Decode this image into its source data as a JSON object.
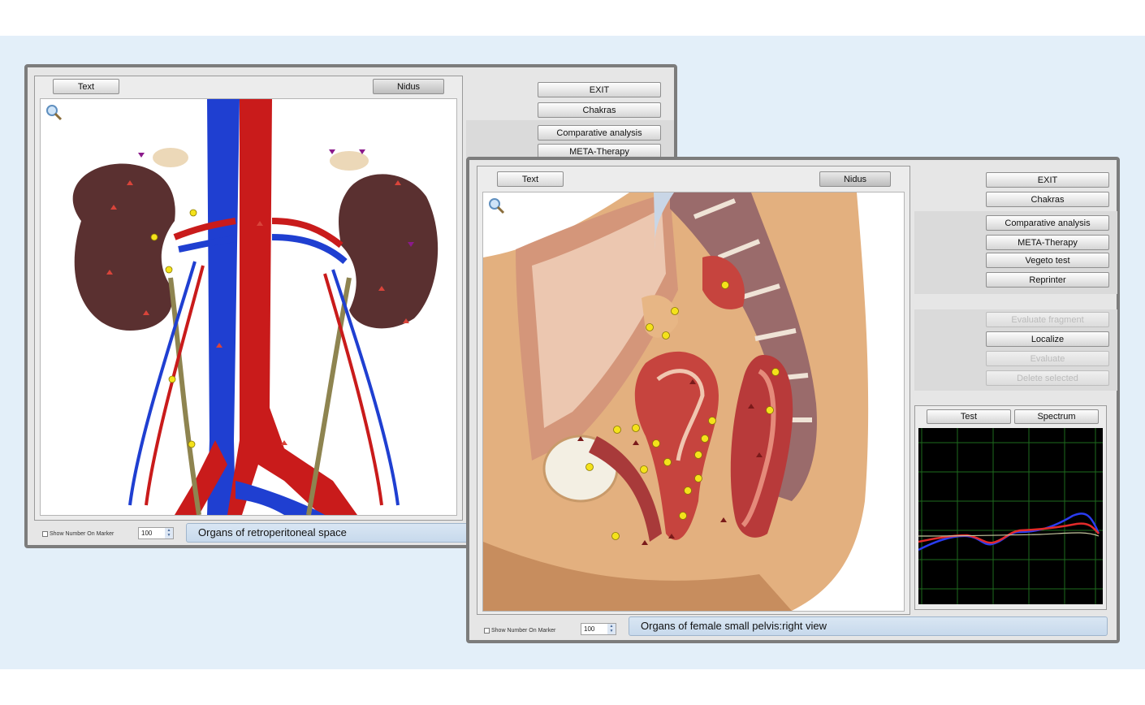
{
  "window_left": {
    "text_button": "Text",
    "nidus_button": "Nidus",
    "side_buttons": [
      "EXIT",
      "Chakras",
      "Comparative analysis",
      "META-Therapy"
    ],
    "show_number_label": "Show Number On Marker",
    "spin_value": "100",
    "caption": "Organs of retroperitoneal space"
  },
  "window_right": {
    "text_button": "Text",
    "nidus_button": "Nidus",
    "side_buttons_top": [
      "EXIT",
      "Chakras"
    ],
    "side_buttons_mid": [
      "Comparative analysis",
      "META-Therapy",
      "Vegeto test",
      "Reprinter"
    ],
    "side_buttons_low": [
      {
        "label": "Evaluate fragment",
        "enabled": false
      },
      {
        "label": "Localize",
        "enabled": true
      },
      {
        "label": "Evaluate",
        "enabled": false
      },
      {
        "label": "Delete selected",
        "enabled": false
      }
    ],
    "test_button": "Test",
    "spectrum_button": "Spectrum",
    "show_number_label": "Show Number On Marker",
    "spin_value": "100",
    "caption": "Organs of female small pelvis:right view"
  },
  "colors": {
    "vein": "#1f3fd1",
    "artery": "#c91b1b",
    "kidney": "#5a3030",
    "marker_yellow": "#f4e21b",
    "graph_grid": "#1e6b1e"
  }
}
